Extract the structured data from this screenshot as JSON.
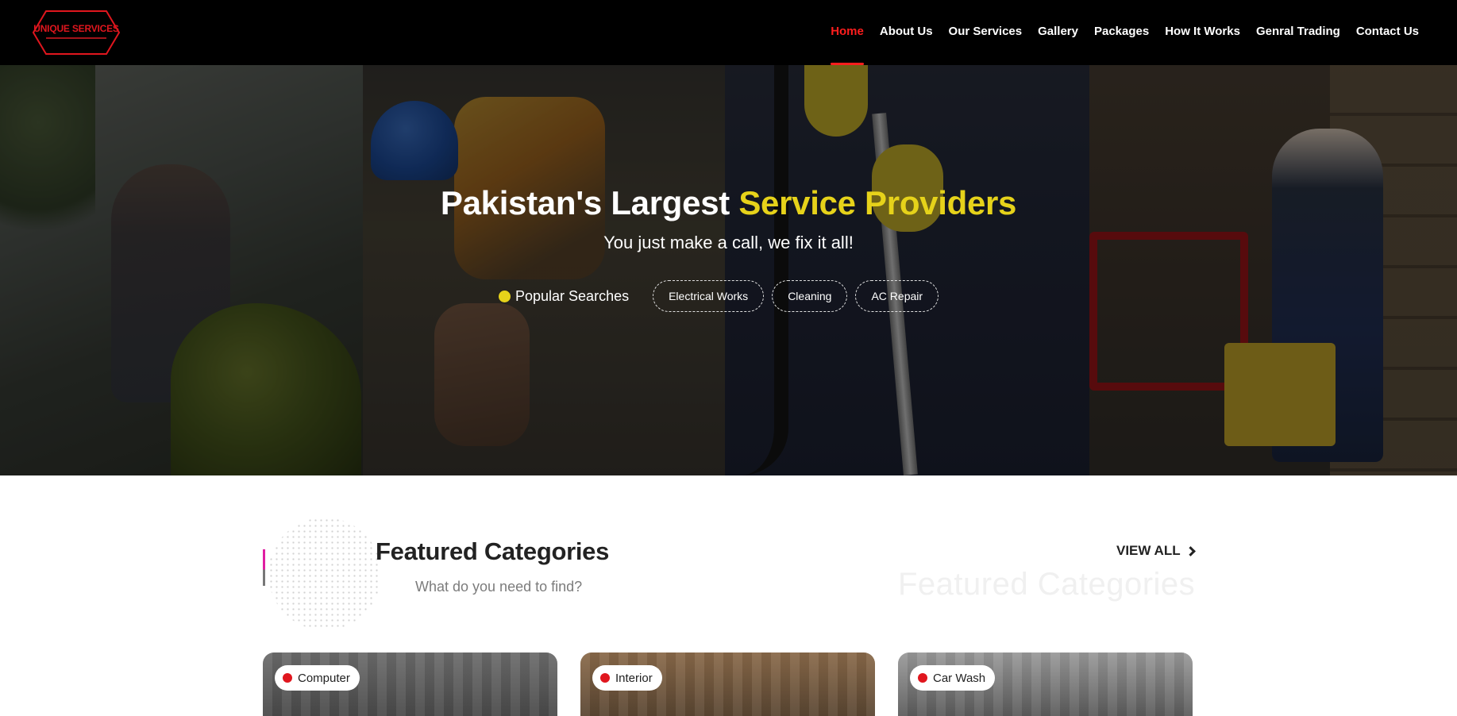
{
  "brand": {
    "logo_text": "UNIQUE SERVICES"
  },
  "nav": {
    "items": [
      {
        "label": "Home"
      },
      {
        "label": "About Us"
      },
      {
        "label": "Our Services"
      },
      {
        "label": "Gallery"
      },
      {
        "label": "Packages"
      },
      {
        "label": "How It Works"
      },
      {
        "label": "Genral Trading"
      },
      {
        "label": "Contact Us"
      }
    ]
  },
  "hero": {
    "title_main": "Pakistan's Largest ",
    "title_accent": "Service Providers",
    "subtitle": "You just make a call, we fix it all!",
    "popular_label": "Popular Searches",
    "chips": [
      "Electrical Works",
      "Cleaning",
      "AC Repair"
    ]
  },
  "featured": {
    "title": "Featured Categories",
    "subtitle": "What do you need to find?",
    "view_all": "VIEW ALL",
    "ghost_title": "Featured Categories",
    "cards": [
      {
        "label": "Computer"
      },
      {
        "label": "Interior"
      },
      {
        "label": "Car Wash"
      }
    ]
  },
  "colors": {
    "accent_red": "#ff1e1e",
    "accent_yellow": "#e6d21a",
    "tag_red": "#e0161e"
  }
}
